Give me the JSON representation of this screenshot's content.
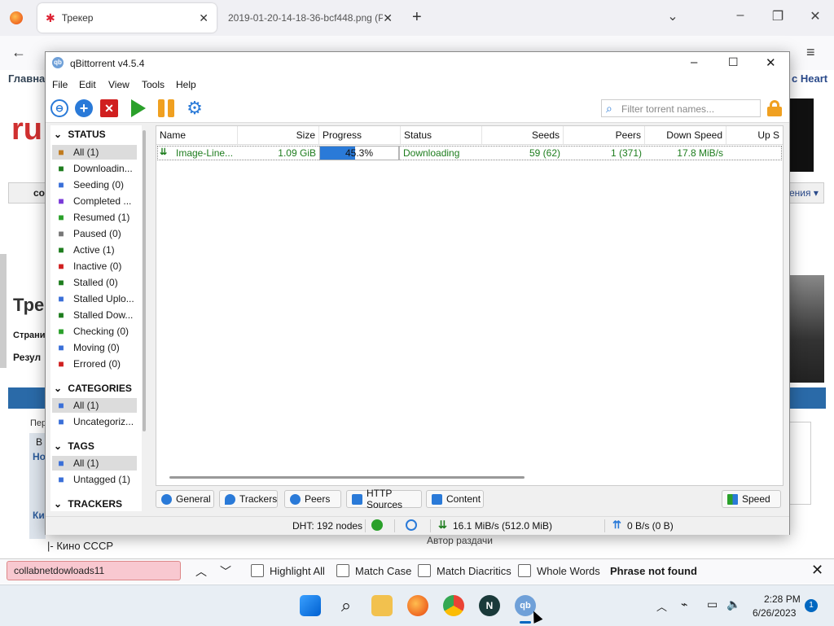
{
  "browser": {
    "tab_active_label": "Трекер",
    "tab_2_label": "2019-01-20-14-18-36-bcf448.png (P",
    "new_tab": "+",
    "bg_nav_left": "Главна",
    "bg_nav_right": "c Heart",
    "bg_texts": {
      "ru": "ru",
      "co": "co",
      "ения": "ения",
      "tre": "Тре",
      "strani": "Страни",
      "rezul": "Резул",
      "per": "Пер",
      "v": "В",
      "no": "Но",
      "ki": "Ки",
      "kino": "|- Кино СССР",
      "avtor": "Автор раздачи"
    }
  },
  "findbar": {
    "value": "collabnetdowloads11",
    "highlight_all": "Highlight All",
    "match_case": "Match Case",
    "match_diacritics": "Match Diacritics",
    "whole_words": "Whole Words",
    "status": "Phrase not found"
  },
  "taskbar": {
    "time": "2:28 PM",
    "date": "6/26/2023",
    "notification_count": "1"
  },
  "qbt": {
    "title": "qBittorrent v4.5.4",
    "menu": [
      "File",
      "Edit",
      "View",
      "Tools",
      "Help"
    ],
    "filter_placeholder": "Filter torrent names...",
    "sidebar": {
      "status_header": "STATUS",
      "status_items": [
        {
          "label": "All (1)",
          "icon": "all-icon",
          "color": "#c07a1e"
        },
        {
          "label": "Downloadin...",
          "icon": "downloading-icon",
          "color": "#1e7d1e"
        },
        {
          "label": "Seeding (0)",
          "icon": "seeding-icon",
          "color": "#3a6fd8"
        },
        {
          "label": "Completed ...",
          "icon": "completed-icon",
          "color": "#7a3ad8"
        },
        {
          "label": "Resumed (1)",
          "icon": "resumed-icon",
          "color": "#2aa02a"
        },
        {
          "label": "Paused (0)",
          "icon": "paused-icon",
          "color": "#777777"
        },
        {
          "label": "Active (1)",
          "icon": "active-icon",
          "color": "#1e7d1e"
        },
        {
          "label": "Inactive (0)",
          "icon": "inactive-icon",
          "color": "#d02020"
        },
        {
          "label": "Stalled (0)",
          "icon": "stalled-icon",
          "color": "#1e7d1e"
        },
        {
          "label": "Stalled Uplo...",
          "icon": "stalled-upload-icon",
          "color": "#3a6fd8"
        },
        {
          "label": "Stalled Dow...",
          "icon": "stalled-download-icon",
          "color": "#1e7d1e"
        },
        {
          "label": "Checking (0)",
          "icon": "checking-icon",
          "color": "#2aa02a"
        },
        {
          "label": "Moving (0)",
          "icon": "moving-icon",
          "color": "#3a6fd8"
        },
        {
          "label": "Errored (0)",
          "icon": "errored-icon",
          "color": "#d02020"
        }
      ],
      "categories_header": "CATEGORIES",
      "category_items": [
        {
          "label": "All (1)",
          "icon": "list-icon",
          "color": "#3a6fd8"
        },
        {
          "label": "Uncategoriz...",
          "icon": "list-icon",
          "color": "#3a6fd8"
        }
      ],
      "tags_header": "TAGS",
      "tag_items": [
        {
          "label": "All (1)",
          "icon": "tag-icon",
          "color": "#3a6fd8"
        },
        {
          "label": "Untagged (1)",
          "icon": "tag-icon",
          "color": "#3a6fd8"
        }
      ],
      "trackers_header": "TRACKERS"
    },
    "columns": [
      "Name",
      "Size",
      "Progress",
      "Status",
      "Seeds",
      "Peers",
      "Down Speed",
      "Up S"
    ],
    "torrent": {
      "name": "Image-Line...",
      "size": "1.09 GiB",
      "progress_text": "45.3%",
      "progress": 0.453,
      "status": "Downloading",
      "seeds": "59 (62)",
      "peers": "1 (371)",
      "down_speed": "17.8 MiB/s"
    },
    "bottom_tabs": [
      "General",
      "Trackers",
      "Peers",
      "HTTP Sources",
      "Content"
    ],
    "speed_button": "Speed",
    "statusbar": {
      "dht": "DHT: 192 nodes",
      "download": "16.1 MiB/s (512.0 MiB)",
      "upload": "0 B/s (0 B)"
    }
  }
}
